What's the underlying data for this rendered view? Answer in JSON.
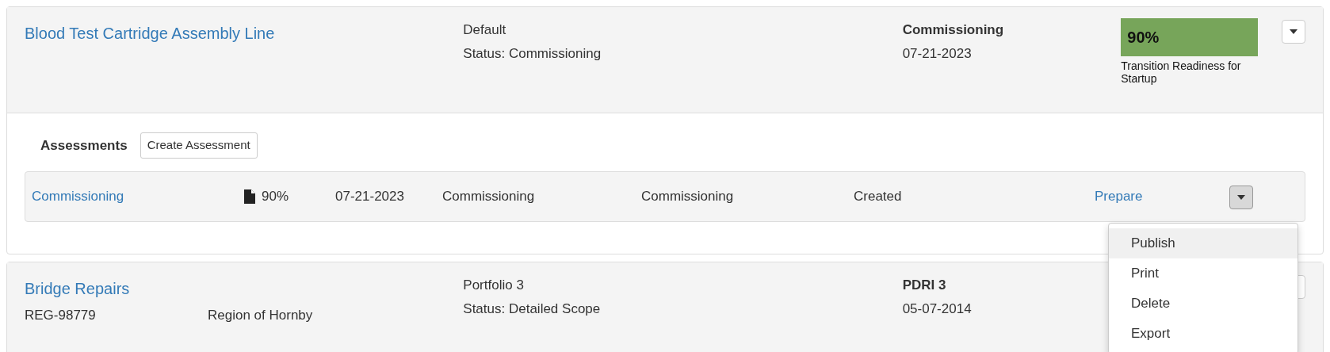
{
  "projects": [
    {
      "title": "Blood Test Cartridge Assembly Line",
      "portfolio": "Default",
      "status": "Status: Commissioning",
      "phase": "Commissioning",
      "date": "07-21-2023",
      "readiness": {
        "value": "90%",
        "label": "Transition Readiness for Startup"
      },
      "expanded": true,
      "assessments": {
        "heading": "Assessments",
        "create_button": "Create Assessment",
        "rows": [
          {
            "name": "Commissioning",
            "score": "90%",
            "date": "07-21-2023",
            "phase": "Commissioning",
            "type": "Commissioning",
            "state": "Created",
            "action": "Prepare",
            "menu_open": true,
            "menu": [
              {
                "label": "Publish",
                "selected": true
              },
              {
                "label": "Print",
                "selected": false
              },
              {
                "label": "Delete",
                "selected": false
              },
              {
                "label": "Export",
                "selected": false
              }
            ]
          }
        ]
      }
    },
    {
      "title": "Bridge Repairs",
      "code": "REG-98779",
      "region": "Region of Hornby",
      "portfolio": "Portfolio 3",
      "status": "Status: Detailed Scope",
      "phase": "PDRI 3",
      "date": "05-07-2014",
      "expanded": false
    }
  ]
}
